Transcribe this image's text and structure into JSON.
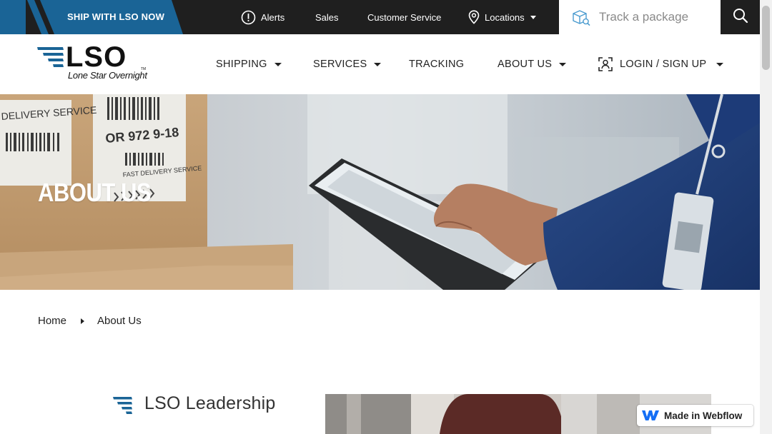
{
  "topbar": {
    "ship_cta": "SHIP WITH LSO NOW",
    "alerts": "Alerts",
    "sales": "Sales",
    "customer_service": "Customer Service",
    "locations": "Locations",
    "track_placeholder": "Track a package"
  },
  "logo": {
    "wordmark": "LSO",
    "tagline": "Lone Star Overnight",
    "trademark": "TM"
  },
  "nav": {
    "shipping": "SHIPPING",
    "services": "SERVICES",
    "tracking": "TRACKING",
    "about_us": "ABOUT US",
    "login": "LOGIN / SIGN UP"
  },
  "hero": {
    "title": "ABOUT US",
    "label_text_1": "DELIVERY SERVICE",
    "label_text_2": "OR 972 9-18",
    "label_text_3": "FAST DELIVERY SERVICE"
  },
  "breadcrumb": {
    "home": "Home",
    "current": "About Us"
  },
  "leadership": {
    "title": "LSO Leadership"
  },
  "badge": {
    "webflow": "Made in Webflow"
  },
  "colors": {
    "brand_blue": "#1a6496",
    "topbar_bg": "#1f1f1f",
    "accent_navy": "#1e3a5f"
  },
  "icons": {
    "alerts": "alert-circle-icon",
    "locations": "map-pin-icon",
    "track": "package-search-icon",
    "search": "search-icon",
    "login": "user-scan-icon",
    "leadership": "speed-lines-icon",
    "webflow": "webflow-logo-icon"
  }
}
